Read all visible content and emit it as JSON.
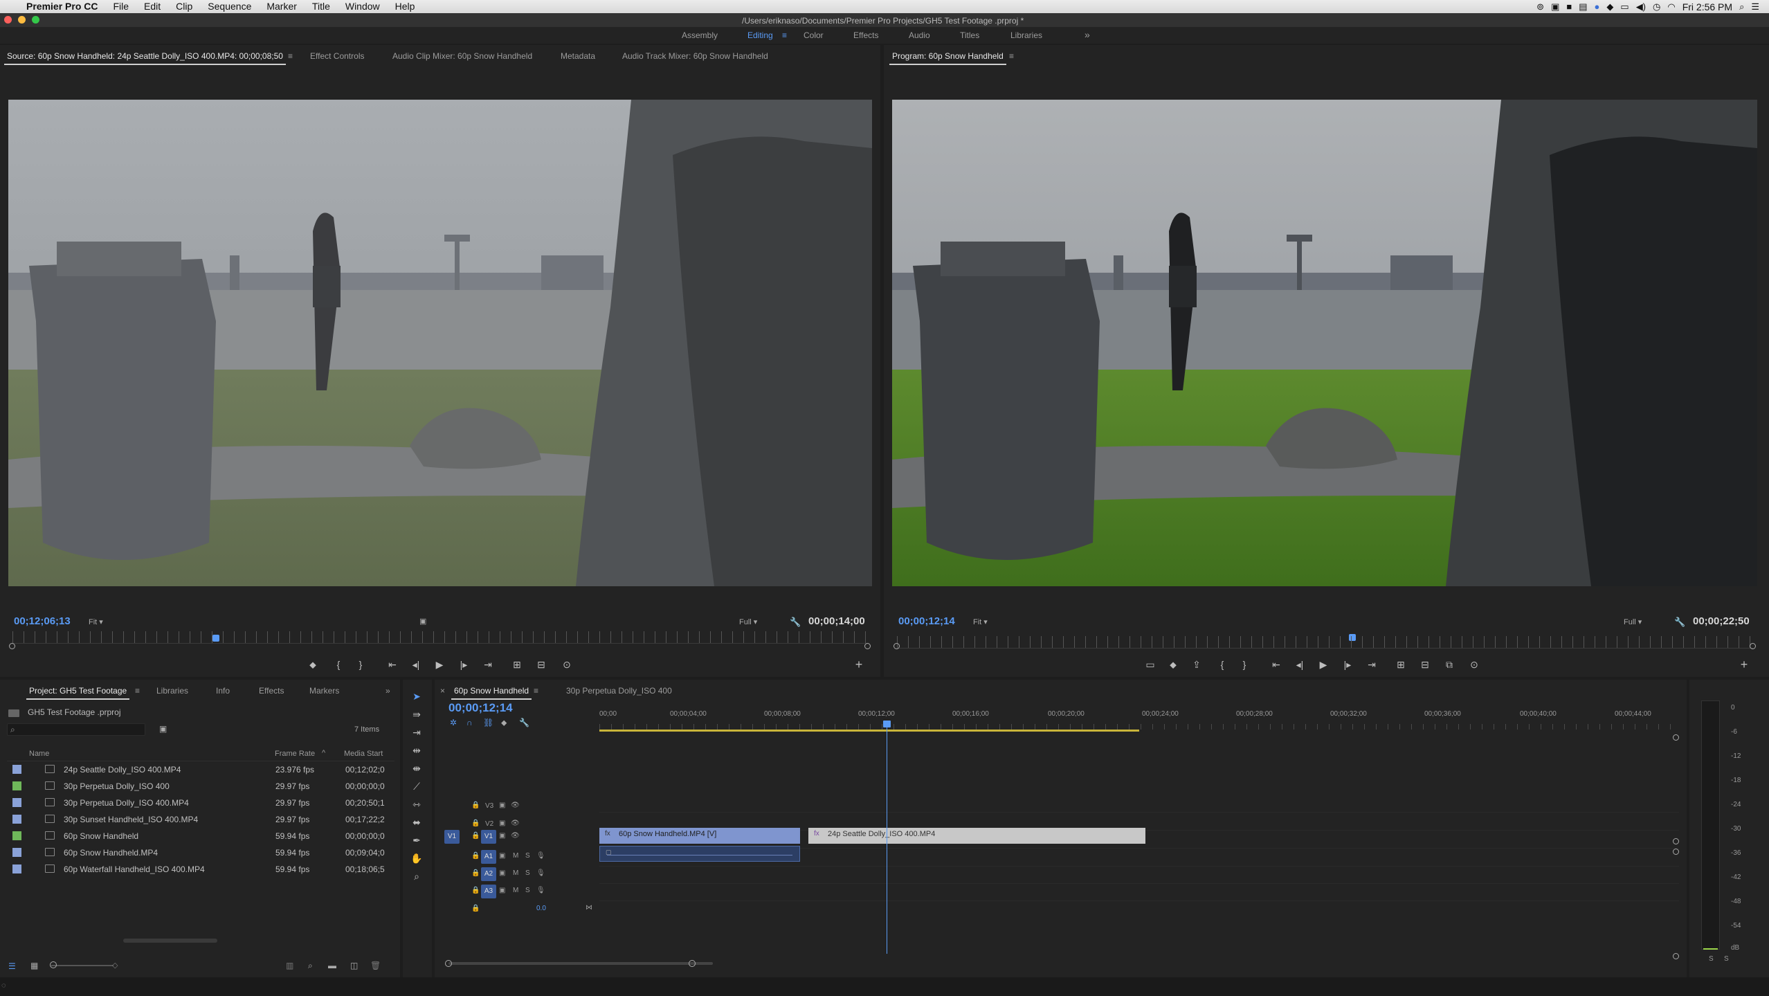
{
  "menubar": {
    "app_name": "Premier Pro CC",
    "items": [
      "File",
      "Edit",
      "Clip",
      "Sequence",
      "Marker",
      "Title",
      "Window",
      "Help"
    ],
    "clock": "Fri 2:56 PM"
  },
  "titlebar": {
    "path": "/Users/eriknaso/Documents/Premier Pro Projects/GH5 Test Footage .prproj *"
  },
  "workspaces": {
    "items": [
      "Assembly",
      "Editing",
      "Color",
      "Effects",
      "Audio",
      "Titles",
      "Libraries"
    ],
    "active": "Editing",
    "more": "»"
  },
  "source": {
    "tabs": [
      "Source: 60p Snow Handheld: 24p Seattle Dolly_ISO 400.MP4: 00;00;08;50",
      "Effect Controls",
      "Audio Clip Mixer: 60p Snow Handheld",
      "Metadata",
      "Audio Track Mixer: 60p Snow Handheld"
    ],
    "timecode": "00;12;06;13",
    "fit": "Fit",
    "quality": "Full",
    "duration": "00;00;14;00"
  },
  "program": {
    "tab": "Program: 60p Snow Handheld",
    "timecode": "00;00;12;14",
    "fit": "Fit",
    "quality": "Full",
    "duration": "00;00;22;50"
  },
  "project": {
    "tabs": [
      "Project: GH5 Test Footage",
      "Libraries",
      "Info",
      "Effects",
      "Markers"
    ],
    "file": "GH5 Test Footage .prproj",
    "item_count": "7 Items",
    "columns": [
      "Name",
      "Frame Rate",
      "Media Start"
    ],
    "rows": [
      {
        "name": "24p Seattle Dolly_ISO 400.MP4",
        "rate": "23.976 fps",
        "start": "00;12;02;0",
        "color": "#8aa2d8"
      },
      {
        "name": "30p Perpetua Dolly_ISO 400",
        "rate": "29.97 fps",
        "start": "00;00;00;0",
        "color": "#6fb85a"
      },
      {
        "name": "30p Perpetua Dolly_ISO 400.MP4",
        "rate": "29.97 fps",
        "start": "00;20;50;1",
        "color": "#8aa2d8"
      },
      {
        "name": "30p Sunset Handheld_ISO 400.MP4",
        "rate": "29.97 fps",
        "start": "00;17;22;2",
        "color": "#8aa2d8"
      },
      {
        "name": "60p Snow Handheld",
        "rate": "59.94 fps",
        "start": "00;00;00;0",
        "color": "#6fb85a"
      },
      {
        "name": "60p Snow Handheld.MP4",
        "rate": "59.94 fps",
        "start": "00;09;04;0",
        "color": "#8aa2d8"
      },
      {
        "name": "60p Waterfall Handheld_ISO 400.MP4",
        "rate": "59.94 fps",
        "start": "00;18;06;5",
        "color": "#8aa2d8"
      }
    ]
  },
  "timeline": {
    "tabs": [
      "60p Snow Handheld",
      "30p Perpetua Dolly_ISO 400"
    ],
    "timecode": "00;00;12;14",
    "ruler": [
      "00;00",
      "00;00;04;00",
      "00;00;08;00",
      "00;00;12;00",
      "00;00;16;00",
      "00;00;20;00",
      "00;00;24;00",
      "00;00;28;00",
      "00;00;32;00",
      "00;00;36;00",
      "00;00;40;00",
      "00;00;44;00"
    ],
    "video_tracks": [
      "V3",
      "V2",
      "V1"
    ],
    "audio_tracks": [
      "A1",
      "A2",
      "A3"
    ],
    "master_volume": "0.0",
    "clips": {
      "v1_a": "60p Snow Handheld.MP4 [V]",
      "v1_b": "24p Seattle Dolly_ISO 400.MP4"
    }
  },
  "meter": {
    "ticks": [
      "0",
      "-6",
      "-12",
      "-18",
      "-24",
      "-30",
      "-36",
      "-42",
      "-48",
      "-54",
      "dB"
    ],
    "solo_labels": [
      "S",
      "S"
    ]
  },
  "colors": {
    "accent": "#5a9bf5",
    "clip_blue": "#7f95cf",
    "clip_grey": "#c8c8c8",
    "playhead": "#5a9bf5",
    "workarea": "#c9b53a"
  }
}
